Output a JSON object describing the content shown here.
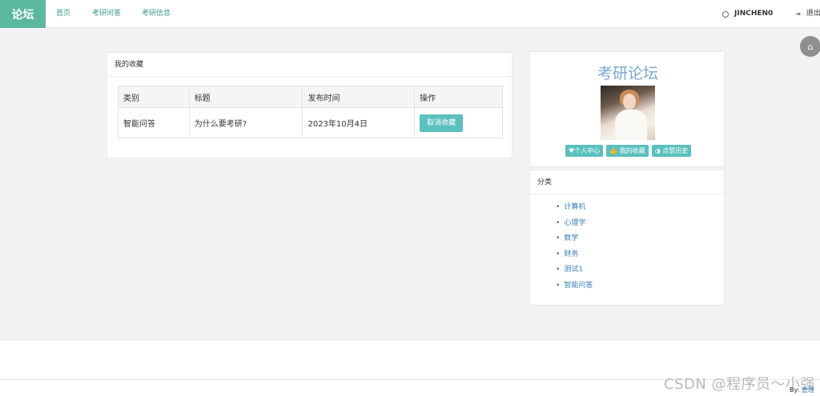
{
  "navbar": {
    "brand": "论坛",
    "links": [
      "首页",
      "考研问答",
      "考研信息"
    ],
    "username": "JINCHEN0",
    "logout": "退出"
  },
  "favorites": {
    "title": "我的收藏",
    "headers": [
      "类别",
      "标题",
      "发布时间",
      "操作"
    ],
    "rows": [
      {
        "category": "智能问答",
        "title": "为什么要考研?",
        "date": "2023年10月4日",
        "action": "取消收藏"
      }
    ]
  },
  "profile": {
    "forum_title": "考研论坛",
    "buttons": [
      "个人中心",
      "我的收藏",
      "点赞历史"
    ]
  },
  "categories": {
    "title": "分类",
    "items": [
      "计算机",
      "心理学",
      "数学",
      "财务",
      "测试1",
      "智能问答"
    ]
  },
  "footer": {
    "by_label": "By:",
    "by_name": "管理",
    "watermark": "CSDN @程序员～小强"
  },
  "colors": {
    "brand_bg": "#5cb89c",
    "accent_button": "#5bc0be",
    "link": "#3a7fb8",
    "forum_title": "#78a8d4"
  }
}
